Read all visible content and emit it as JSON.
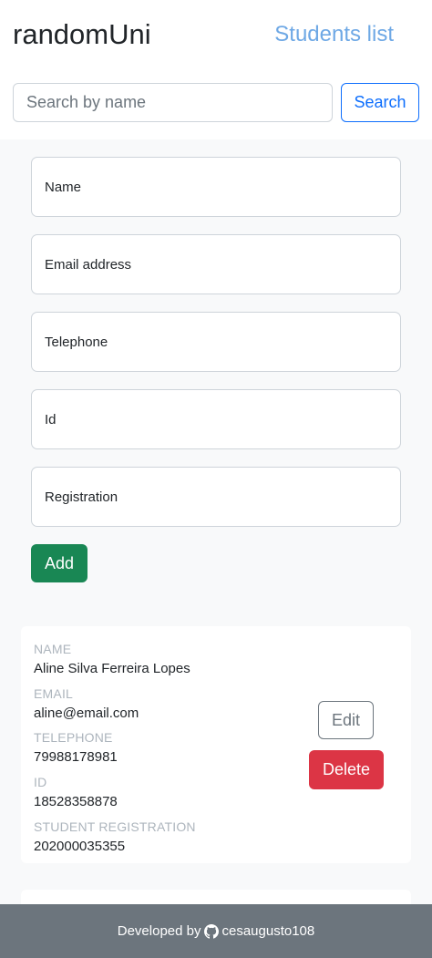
{
  "header": {
    "brand": "randomUni",
    "nav_link": "Students list"
  },
  "search": {
    "placeholder": "Search by name",
    "button_label": "Search"
  },
  "form": {
    "fields": [
      {
        "placeholder": "Name"
      },
      {
        "placeholder": "Email address"
      },
      {
        "placeholder": "Telephone"
      },
      {
        "placeholder": "Id"
      },
      {
        "placeholder": "Registration"
      }
    ],
    "add_label": "Add"
  },
  "students": [
    {
      "name_label": "NAME",
      "name": "Aline Silva Ferreira Lopes",
      "email_label": "EMAIL",
      "email": "aline@email.com",
      "telephone_label": "TELEPHONE",
      "telephone": "79988178981",
      "id_label": "ID",
      "id": "18528358878",
      "registration_label": "STUDENT REGISTRATION",
      "registration": "202000035355",
      "edit_label": "Edit",
      "delete_label": "Delete"
    }
  ],
  "footer": {
    "prefix": "Developed by",
    "author": "cesaugusto108",
    "icon": "github-icon"
  },
  "colors": {
    "primary": "#0d6efd",
    "success": "#198754",
    "danger": "#dc3545",
    "secondary": "#6c757d",
    "nav_link": "#6ea8e5"
  }
}
